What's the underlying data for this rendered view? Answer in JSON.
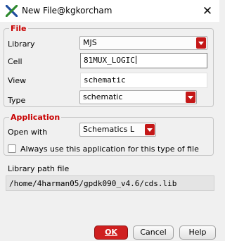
{
  "window": {
    "title": "New File@kgkorcham",
    "close_glyph": "✕",
    "icon": "x-logo-icon"
  },
  "file_group": {
    "legend": "File",
    "library_label": "Library",
    "library_value": "MJS",
    "cell_label": "Cell",
    "cell_value": "81MUX_LOGIC",
    "view_label": "View",
    "view_value": "schematic",
    "type_label": "Type",
    "type_value": "schematic"
  },
  "application_group": {
    "legend": "Application",
    "open_with_label": "Open with",
    "open_with_value": "Schematics L",
    "always_use_label": "Always use this application for this type of file",
    "always_use_checked": false
  },
  "library_path": {
    "label": "Library path file",
    "value": "/home/4harman05/gpdk090_v4.6/cds.lib"
  },
  "buttons": {
    "ok": "OK",
    "cancel": "Cancel",
    "help": "Help"
  },
  "colors": {
    "accent": "#c80000",
    "button_ok": "#cf1f1f"
  }
}
